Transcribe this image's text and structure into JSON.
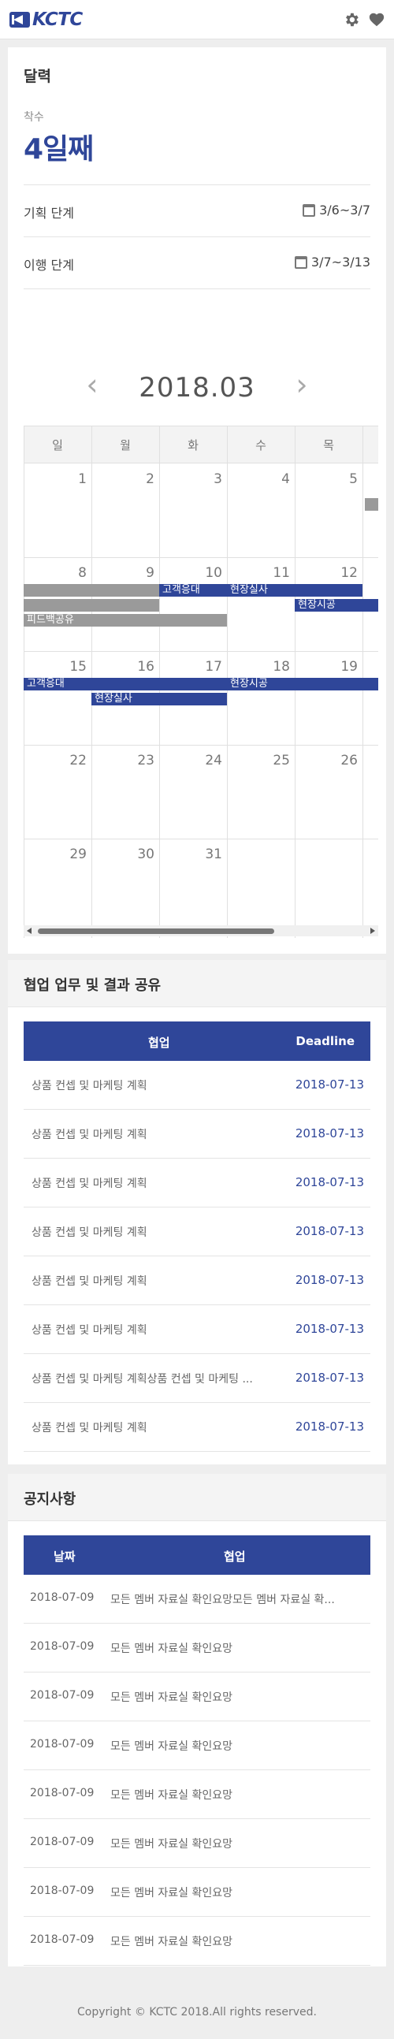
{
  "header": {
    "logo_text": "KCTC",
    "icons": [
      "gear-icon",
      "heart-icon"
    ]
  },
  "calendar_panel": {
    "title": "달력",
    "start_label": "착수",
    "day_count": "4일째",
    "rows": [
      {
        "label": "기획 단계",
        "value": "3/6~3/7"
      },
      {
        "label": "이행 단계",
        "value": "3/7~3/13"
      }
    ],
    "month": "2018.03",
    "weekdays": [
      "일",
      "월",
      "화",
      "수",
      "목"
    ],
    "weeks": [
      [
        "",
        "",
        "",
        "",
        "1",
        "2",
        "3",
        "4",
        "5"
      ],
      [
        "1",
        "2",
        "3",
        "4",
        "5"
      ],
      [
        "8",
        "9",
        "10",
        "11",
        "12"
      ],
      [
        "15",
        "16",
        "17",
        "18",
        "19"
      ],
      [
        "22",
        "23",
        "24",
        "25",
        "26"
      ],
      [
        "29",
        "30",
        "31",
        "",
        ""
      ]
    ],
    "events": {
      "e1": "고객응대",
      "e2": "현장실사",
      "e3": "현장시공",
      "e4": "피드백공유",
      "e5": "고객응대",
      "e6": "현장시공",
      "e7": "현장실사"
    },
    "colors": {
      "accent": "#2f4699",
      "gray_event": "#9a9a9a"
    }
  },
  "collab": {
    "title": "협업 업무 및 결과 공유",
    "columns": [
      "협업",
      "Deadline"
    ],
    "rows": [
      {
        "task": "상품 컨셉 및 마케팅 계획",
        "deadline": "2018-07-13"
      },
      {
        "task": "상품 컨셉 및 마케팅 계획",
        "deadline": "2018-07-13"
      },
      {
        "task": "상품 컨셉 및 마케팅 계획",
        "deadline": "2018-07-13"
      },
      {
        "task": "상품 컨셉 및 마케팅 계획",
        "deadline": "2018-07-13"
      },
      {
        "task": "상품 컨셉 및 마케팅 계획",
        "deadline": "2018-07-13"
      },
      {
        "task": "상품 컨셉 및 마케팅 계획",
        "deadline": "2018-07-13"
      },
      {
        "task": "상품 컨셉 및 마케팅 계획상품 컨셉 및 마케팅 ...",
        "deadline": "2018-07-13"
      },
      {
        "task": "상품 컨셉 및 마케팅 계획",
        "deadline": "2018-07-13"
      }
    ]
  },
  "notice": {
    "title": "공지사항",
    "columns": [
      "날짜",
      "협업"
    ],
    "rows": [
      {
        "date": "2018-07-09",
        "text": "모든 멤버 자료실 확인요망모든 멤버 자료실 확..."
      },
      {
        "date": "2018-07-09",
        "text": "모든 멤버 자료실 확인요망"
      },
      {
        "date": "2018-07-09",
        "text": "모든 멤버 자료실 확인요망"
      },
      {
        "date": "2018-07-09",
        "text": "모든 멤버 자료실 확인요망"
      },
      {
        "date": "2018-07-09",
        "text": "모든 멤버 자료실 확인요망"
      },
      {
        "date": "2018-07-09",
        "text": "모든 멤버 자료실 확인요망"
      },
      {
        "date": "2018-07-09",
        "text": "모든 멤버 자료실 확인요망"
      },
      {
        "date": "2018-07-09",
        "text": "모든 멤버 자료실 확인요망"
      }
    ]
  },
  "footer": {
    "copyright": "Copyright © KCTC 2018.All rights reserved."
  }
}
